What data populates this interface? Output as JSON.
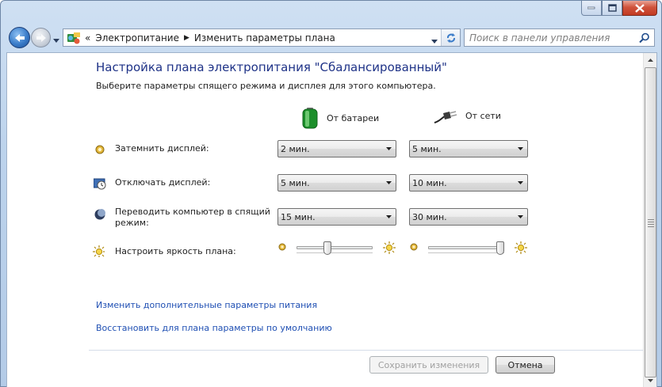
{
  "window": {
    "title_ghost": "",
    "minimize_label": "",
    "maximize_label": "",
    "close_label": ""
  },
  "address": {
    "prefix": "«",
    "crumbs": [
      "Электропитание",
      "Изменить параметры плана"
    ]
  },
  "search": {
    "placeholder": "Поиск в панели управления"
  },
  "page": {
    "title": "Настройка плана электропитания \"Сбалансированный\"",
    "subtitle": "Выберите параметры спящего режима и дисплея для этого компьютера."
  },
  "columns": {
    "battery": "От батареи",
    "plugged": "От сети"
  },
  "rows": [
    {
      "label": "Затемнить дисплей:",
      "battery": "2 мин.",
      "plugged": "5 мин."
    },
    {
      "label": "Отключать дисплей:",
      "battery": "5 мин.",
      "plugged": "10 мин."
    },
    {
      "label_line1": "Переводить компьютер в спящий",
      "label_line2": "режим:",
      "battery": "15 мин.",
      "plugged": "30 мин."
    }
  ],
  "brightness": {
    "label": "Настроить яркость плана:",
    "battery_level": 0.4,
    "plugged_level": 1.0
  },
  "links": {
    "advanced": "Изменить дополнительные параметры питания",
    "restore": "Восстановить для плана параметры по умолчанию"
  },
  "buttons": {
    "save": "Сохранить изменения",
    "cancel": "Отмена"
  },
  "colors": {
    "title": "#1e3287",
    "link": "#1f4fb3",
    "accent": "#3a7cc9"
  }
}
